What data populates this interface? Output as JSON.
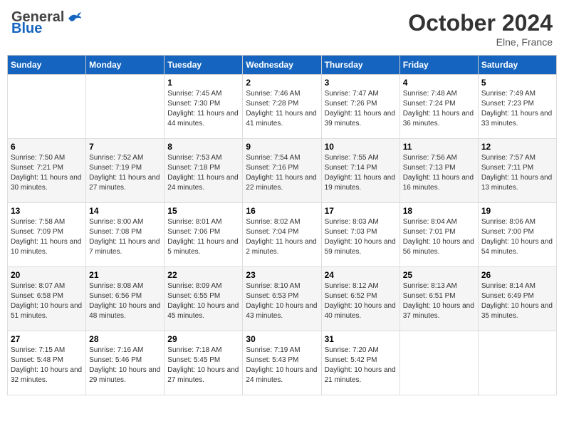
{
  "header": {
    "logo_general": "General",
    "logo_blue": "Blue",
    "month": "October 2024",
    "location": "Elne, France"
  },
  "days_of_week": [
    "Sunday",
    "Monday",
    "Tuesday",
    "Wednesday",
    "Thursday",
    "Friday",
    "Saturday"
  ],
  "weeks": [
    [
      {
        "num": "",
        "detail": ""
      },
      {
        "num": "",
        "detail": ""
      },
      {
        "num": "1",
        "detail": "Sunrise: 7:45 AM\nSunset: 7:30 PM\nDaylight: 11 hours and 44 minutes."
      },
      {
        "num": "2",
        "detail": "Sunrise: 7:46 AM\nSunset: 7:28 PM\nDaylight: 11 hours and 41 minutes."
      },
      {
        "num": "3",
        "detail": "Sunrise: 7:47 AM\nSunset: 7:26 PM\nDaylight: 11 hours and 39 minutes."
      },
      {
        "num": "4",
        "detail": "Sunrise: 7:48 AM\nSunset: 7:24 PM\nDaylight: 11 hours and 36 minutes."
      },
      {
        "num": "5",
        "detail": "Sunrise: 7:49 AM\nSunset: 7:23 PM\nDaylight: 11 hours and 33 minutes."
      }
    ],
    [
      {
        "num": "6",
        "detail": "Sunrise: 7:50 AM\nSunset: 7:21 PM\nDaylight: 11 hours and 30 minutes."
      },
      {
        "num": "7",
        "detail": "Sunrise: 7:52 AM\nSunset: 7:19 PM\nDaylight: 11 hours and 27 minutes."
      },
      {
        "num": "8",
        "detail": "Sunrise: 7:53 AM\nSunset: 7:18 PM\nDaylight: 11 hours and 24 minutes."
      },
      {
        "num": "9",
        "detail": "Sunrise: 7:54 AM\nSunset: 7:16 PM\nDaylight: 11 hours and 22 minutes."
      },
      {
        "num": "10",
        "detail": "Sunrise: 7:55 AM\nSunset: 7:14 PM\nDaylight: 11 hours and 19 minutes."
      },
      {
        "num": "11",
        "detail": "Sunrise: 7:56 AM\nSunset: 7:13 PM\nDaylight: 11 hours and 16 minutes."
      },
      {
        "num": "12",
        "detail": "Sunrise: 7:57 AM\nSunset: 7:11 PM\nDaylight: 11 hours and 13 minutes."
      }
    ],
    [
      {
        "num": "13",
        "detail": "Sunrise: 7:58 AM\nSunset: 7:09 PM\nDaylight: 11 hours and 10 minutes."
      },
      {
        "num": "14",
        "detail": "Sunrise: 8:00 AM\nSunset: 7:08 PM\nDaylight: 11 hours and 7 minutes."
      },
      {
        "num": "15",
        "detail": "Sunrise: 8:01 AM\nSunset: 7:06 PM\nDaylight: 11 hours and 5 minutes."
      },
      {
        "num": "16",
        "detail": "Sunrise: 8:02 AM\nSunset: 7:04 PM\nDaylight: 11 hours and 2 minutes."
      },
      {
        "num": "17",
        "detail": "Sunrise: 8:03 AM\nSunset: 7:03 PM\nDaylight: 10 hours and 59 minutes."
      },
      {
        "num": "18",
        "detail": "Sunrise: 8:04 AM\nSunset: 7:01 PM\nDaylight: 10 hours and 56 minutes."
      },
      {
        "num": "19",
        "detail": "Sunrise: 8:06 AM\nSunset: 7:00 PM\nDaylight: 10 hours and 54 minutes."
      }
    ],
    [
      {
        "num": "20",
        "detail": "Sunrise: 8:07 AM\nSunset: 6:58 PM\nDaylight: 10 hours and 51 minutes."
      },
      {
        "num": "21",
        "detail": "Sunrise: 8:08 AM\nSunset: 6:56 PM\nDaylight: 10 hours and 48 minutes."
      },
      {
        "num": "22",
        "detail": "Sunrise: 8:09 AM\nSunset: 6:55 PM\nDaylight: 10 hours and 45 minutes."
      },
      {
        "num": "23",
        "detail": "Sunrise: 8:10 AM\nSunset: 6:53 PM\nDaylight: 10 hours and 43 minutes."
      },
      {
        "num": "24",
        "detail": "Sunrise: 8:12 AM\nSunset: 6:52 PM\nDaylight: 10 hours and 40 minutes."
      },
      {
        "num": "25",
        "detail": "Sunrise: 8:13 AM\nSunset: 6:51 PM\nDaylight: 10 hours and 37 minutes."
      },
      {
        "num": "26",
        "detail": "Sunrise: 8:14 AM\nSunset: 6:49 PM\nDaylight: 10 hours and 35 minutes."
      }
    ],
    [
      {
        "num": "27",
        "detail": "Sunrise: 7:15 AM\nSunset: 5:48 PM\nDaylight: 10 hours and 32 minutes."
      },
      {
        "num": "28",
        "detail": "Sunrise: 7:16 AM\nSunset: 5:46 PM\nDaylight: 10 hours and 29 minutes."
      },
      {
        "num": "29",
        "detail": "Sunrise: 7:18 AM\nSunset: 5:45 PM\nDaylight: 10 hours and 27 minutes."
      },
      {
        "num": "30",
        "detail": "Sunrise: 7:19 AM\nSunset: 5:43 PM\nDaylight: 10 hours and 24 minutes."
      },
      {
        "num": "31",
        "detail": "Sunrise: 7:20 AM\nSunset: 5:42 PM\nDaylight: 10 hours and 21 minutes."
      },
      {
        "num": "",
        "detail": ""
      },
      {
        "num": "",
        "detail": ""
      }
    ]
  ]
}
